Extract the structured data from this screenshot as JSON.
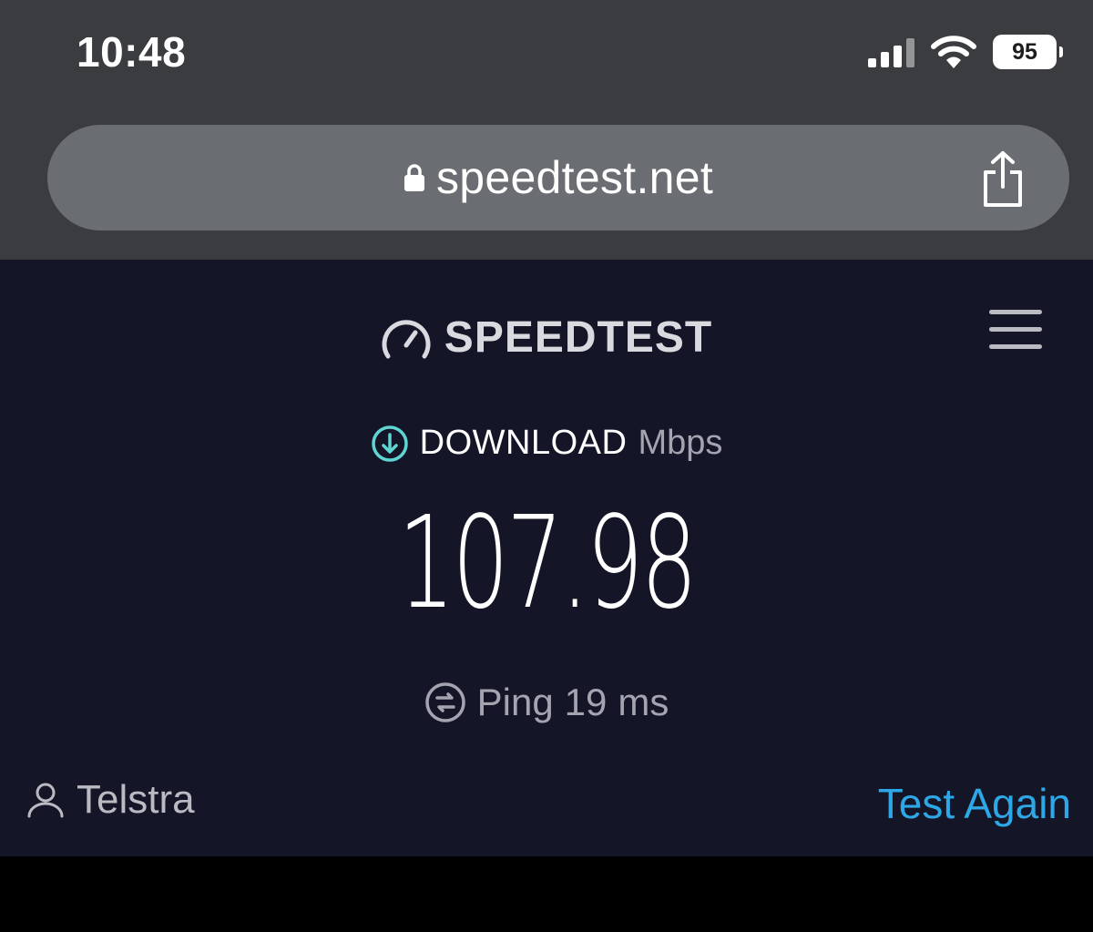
{
  "status_bar": {
    "time": "10:48",
    "battery_level": "95",
    "icons": [
      "cellular-signal-icon",
      "wifi-icon",
      "battery-icon"
    ]
  },
  "browser": {
    "url": "speedtest.net",
    "icons": [
      "lock-icon",
      "share-icon"
    ]
  },
  "header": {
    "logo_text": "SPEEDTEST",
    "icons": [
      "speedometer-icon",
      "hamburger-menu-icon"
    ]
  },
  "result": {
    "download_label": "DOWNLOAD",
    "download_unit": "Mbps",
    "download_value": "107.98",
    "ping_label": "Ping",
    "ping_value": "19",
    "ping_unit": "ms"
  },
  "footer": {
    "provider": "Telstra",
    "test_again_label": "Test Again"
  },
  "colors": {
    "chrome_bg": "#3a3c3f",
    "url_bar_bg": "#6a6d71",
    "page_bg": "#141526",
    "download_icon": "#5fd6d4",
    "link": "#2ea7e6",
    "muted_text": "#a3a4b0"
  }
}
